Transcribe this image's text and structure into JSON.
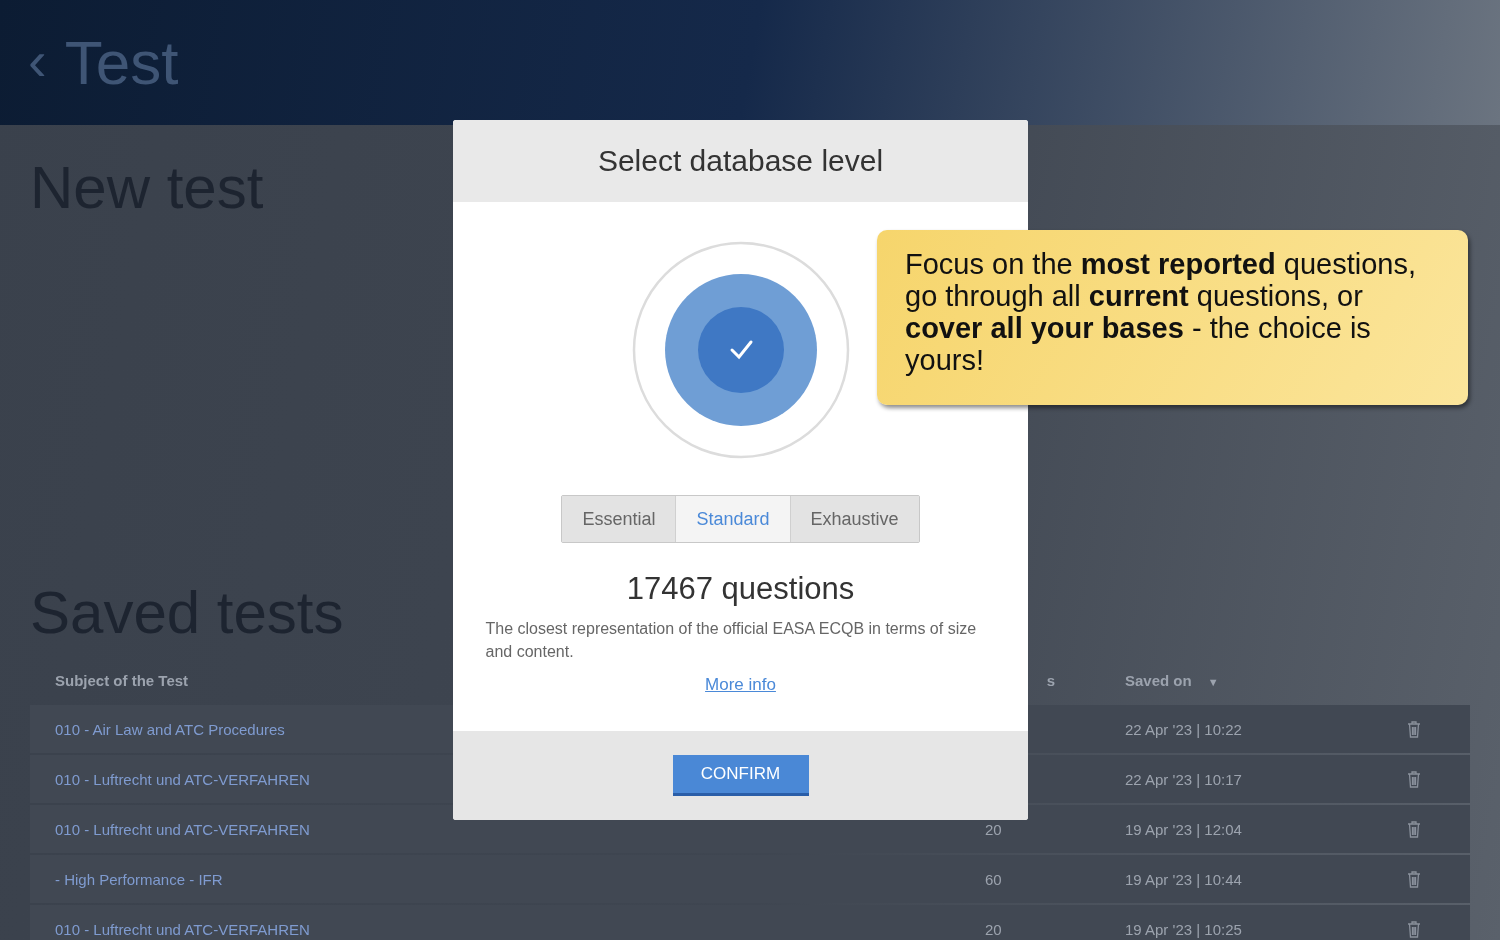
{
  "header": {
    "back_icon": "‹",
    "title": "Test"
  },
  "new_test": {
    "title": "New test"
  },
  "saved_tests": {
    "title": "Saved tests",
    "columns": [
      {
        "label": "Subject of the Test"
      },
      {
        "label": "s"
      },
      {
        "label": "Saved on",
        "sort": "▼"
      }
    ],
    "rows": [
      {
        "subject": "010 - Air Law and ATC Procedures",
        "saved_on": "22 Apr '23 | 10:22"
      },
      {
        "subject": "010 - Luftrecht und ATC-VERFAHREN",
        "saved_on": "22 Apr '23 | 10:17"
      },
      {
        "subject": "010 - Luftrecht und ATC-VERFAHREN",
        "count": "20",
        "saved_on": "19 Apr '23 | 12:04"
      },
      {
        "subject": "- High Performance - IFR",
        "count": "60",
        "saved_on": "19 Apr '23 | 10:44"
      },
      {
        "subject": "010 - Luftrecht und ATC-VERFAHREN",
        "count": "20",
        "saved_on": "19 Apr '23 | 10:25"
      }
    ]
  },
  "modal": {
    "title": "Select database level",
    "levels": [
      {
        "label": "Essential",
        "selected": false
      },
      {
        "label": "Standard",
        "selected": true
      },
      {
        "label": "Exhaustive",
        "selected": false
      }
    ],
    "count": "17467 questions",
    "description": "The closest representation of the official EASA ECQB in terms of size and content.",
    "link": "More info",
    "confirm": "CONFIRM"
  },
  "tooltip": {
    "text": "Focus on the **most reported** questions, go through all **current** questions, or **cover all your bases** - the choice is yours!"
  }
}
